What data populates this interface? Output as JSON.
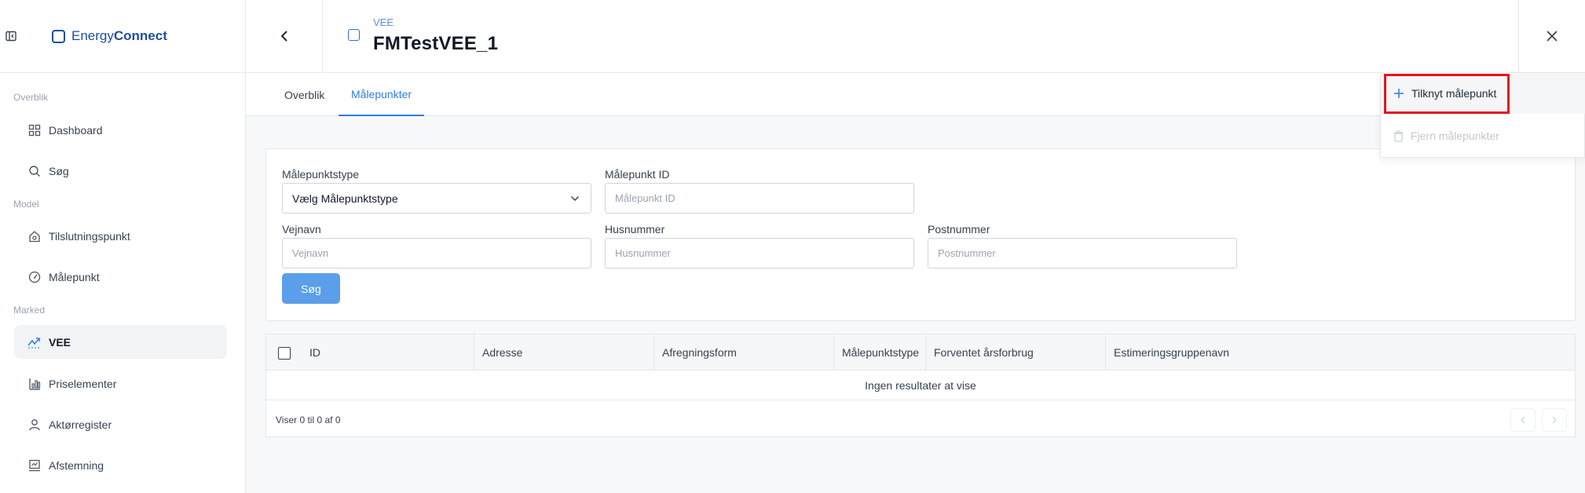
{
  "app": {
    "brand_part1": "Energy",
    "brand_part2": "Connect"
  },
  "sidebar": {
    "sections": {
      "overview": "Overblik",
      "model": "Model",
      "market": "Marked"
    },
    "items": [
      {
        "label": "Dashboard",
        "icon": "grid-icon"
      },
      {
        "label": "Søg",
        "icon": "search-icon"
      },
      {
        "label": "Tilslutningspunkt",
        "icon": "house-icon"
      },
      {
        "label": "Målepunkt",
        "icon": "gauge-icon"
      },
      {
        "label": "VEE",
        "icon": "trend-icon",
        "active": true
      },
      {
        "label": "Priselementer",
        "icon": "bar-chart-icon"
      },
      {
        "label": "Aktørregister",
        "icon": "user-icon"
      },
      {
        "label": "Afstemning",
        "icon": "checkbox-chart-icon"
      }
    ]
  },
  "header": {
    "breadcrumb": "VEE",
    "title": "FMTestVEE_1"
  },
  "tabs": [
    {
      "label": "Overblik",
      "active": false
    },
    {
      "label": "Målepunkter",
      "active": true
    }
  ],
  "filters": {
    "type_label": "Målepunktstype",
    "type_value": "Vælg Målepunktstype",
    "id_label": "Målepunkt ID",
    "id_placeholder": "Målepunkt ID",
    "street_label": "Vejnavn",
    "street_placeholder": "Vejnavn",
    "house_label": "Husnummer",
    "house_placeholder": "Husnummer",
    "zip_label": "Postnummer",
    "zip_placeholder": "Postnummer",
    "search_button": "Søg"
  },
  "table": {
    "columns": [
      "ID",
      "Adresse",
      "Afregningsform",
      "Målepunktstype",
      "Forventet årsforbrug",
      "Estimeringsgruppenavn"
    ],
    "empty_text": "Ingen resultater at vise",
    "footer": "Viser 0 til 0 af 0"
  },
  "dropdown": {
    "attach": "Tilknyt målepunkt",
    "remove": "Fjern målepunkter"
  },
  "colors": {
    "brand": "#1d4e9e",
    "accent": "#2f7de1",
    "button": "#5b9ee9",
    "highlight": "#e2161b"
  }
}
